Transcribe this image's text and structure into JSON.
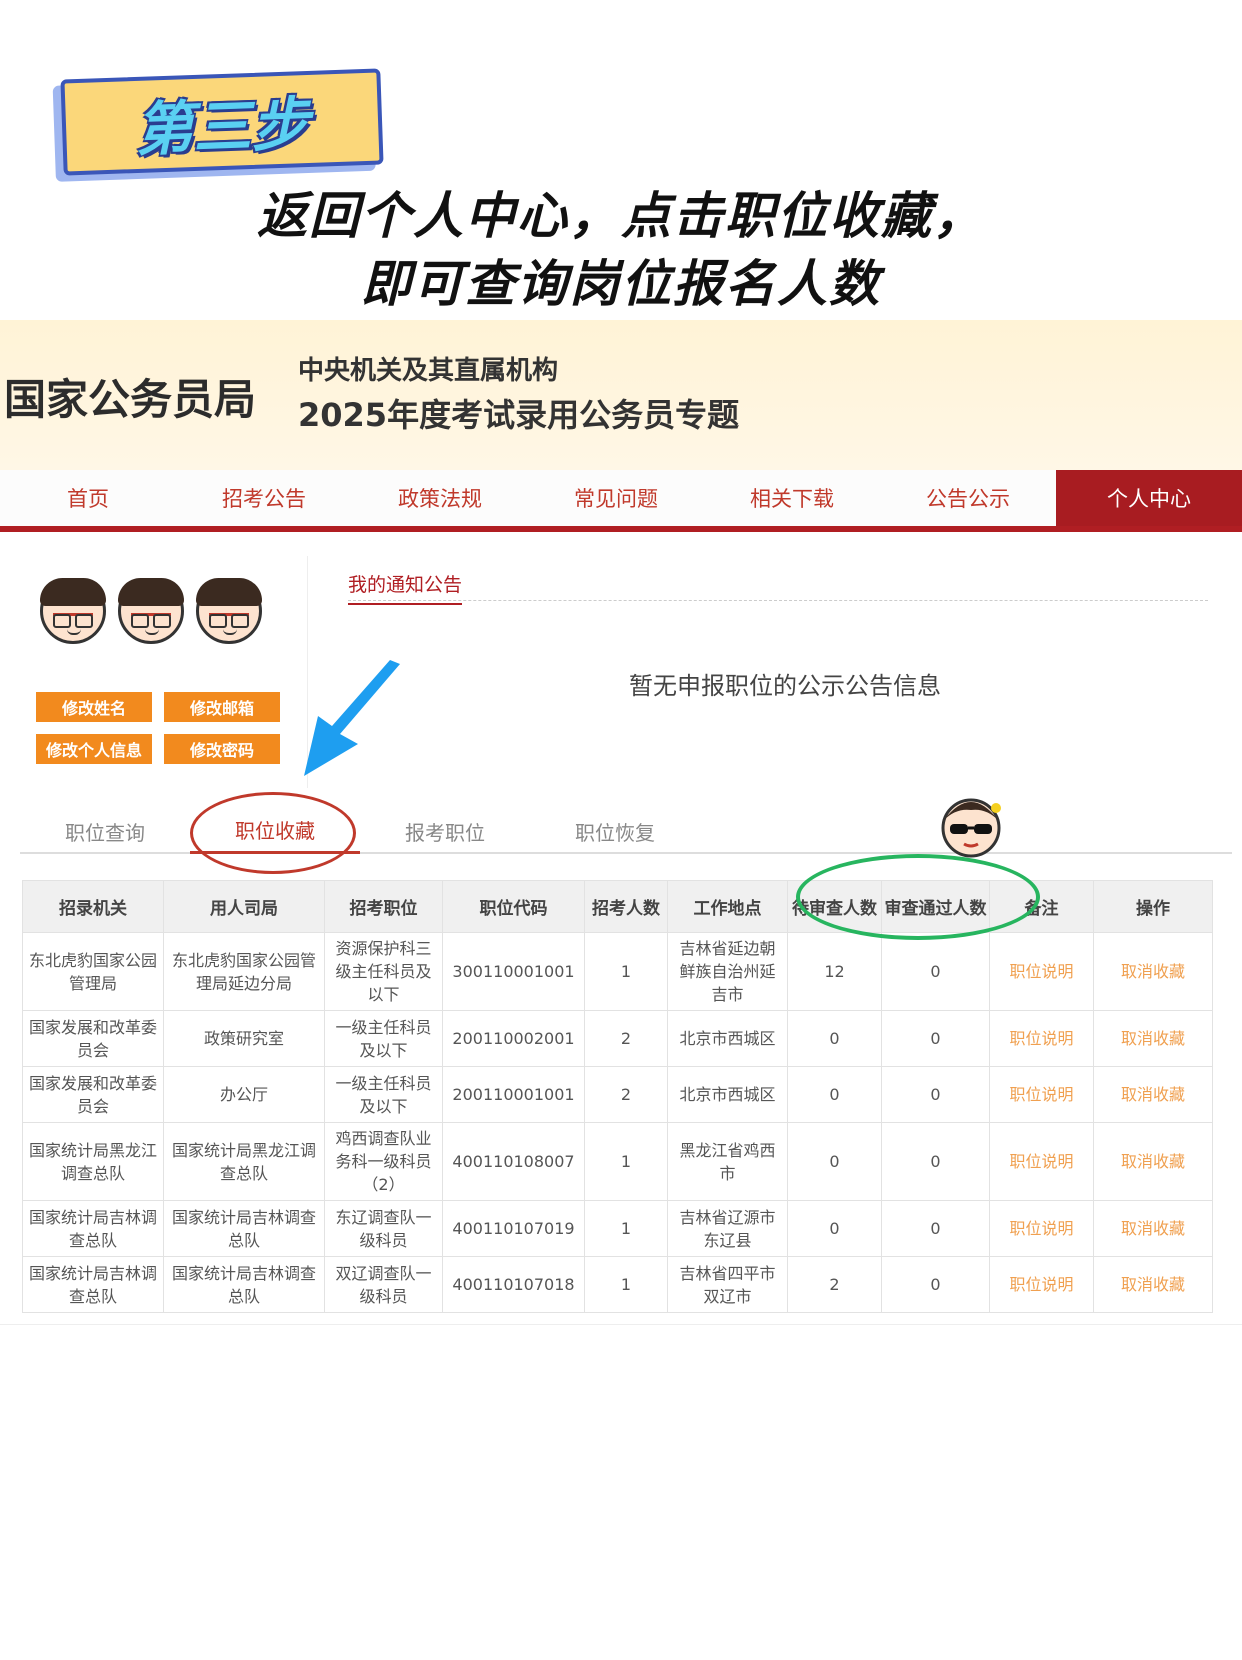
{
  "step": {
    "badge": "第三步"
  },
  "headline": {
    "line1": "返回个人中心，点击职位收藏，",
    "line2": "即可查询岗位报名人数"
  },
  "banner": {
    "org_name": "国家公务员局",
    "sub1": "中央机关及其直属机构",
    "sub2": "2025年度考试录用公务员专题"
  },
  "nav": {
    "items": [
      "首页",
      "招考公告",
      "政策法规",
      "常见问题",
      "相关下载",
      "公告公示"
    ],
    "active": "个人中心"
  },
  "profile": {
    "buttons": [
      "修改姓名",
      "修改邮箱",
      "修改个人信息",
      "修改密码"
    ]
  },
  "notice": {
    "title": "我的通知公告",
    "empty": "暂无申报职位的公示公告信息"
  },
  "tabs": [
    "职位查询",
    "职位收藏",
    "报考职位",
    "职位恢复"
  ],
  "table": {
    "headers": [
      "招录机关",
      "用人司局",
      "招考职位",
      "职位代码",
      "招考人数",
      "工作地点",
      "待审查人数",
      "审查通过人数",
      "备注",
      "操作"
    ],
    "rows": [
      [
        "东北虎豹国家公园管理局",
        "东北虎豹国家公园管理局延边分局",
        "资源保护科三级主任科员及以下",
        "300110001001",
        "1",
        "吉林省延边朝鲜族自治州延吉市",
        "12",
        "0",
        "职位说明",
        "取消收藏"
      ],
      [
        "国家发展和改革委员会",
        "政策研究室",
        "一级主任科员及以下",
        "200110002001",
        "2",
        "北京市西城区",
        "0",
        "0",
        "职位说明",
        "取消收藏"
      ],
      [
        "国家发展和改革委员会",
        "办公厅",
        "一级主任科员及以下",
        "200110001001",
        "2",
        "北京市西城区",
        "0",
        "0",
        "职位说明",
        "取消收藏"
      ],
      [
        "国家统计局黑龙江调查总队",
        "国家统计局黑龙江调查总队",
        "鸡西调查队业务科一级科员（2）",
        "400110108007",
        "1",
        "黑龙江省鸡西市",
        "0",
        "0",
        "职位说明",
        "取消收藏"
      ],
      [
        "国家统计局吉林调查总队",
        "国家统计局吉林调查总队",
        "东辽调查队一级科员",
        "400110107019",
        "1",
        "吉林省辽源市东辽县",
        "0",
        "0",
        "职位说明",
        "取消收藏"
      ],
      [
        "国家统计局吉林调查总队",
        "国家统计局吉林调查总队",
        "双辽调查队一级科员",
        "400110107018",
        "1",
        "吉林省四平市双辽市",
        "2",
        "0",
        "职位说明",
        "取消收藏"
      ]
    ]
  },
  "colors": {
    "brand_red": "#b01e23",
    "orange_button": "#f28a1e",
    "link_orange": "#f0a050",
    "highlight_green": "#27b55f",
    "arrow_blue": "#1e9ef0"
  }
}
